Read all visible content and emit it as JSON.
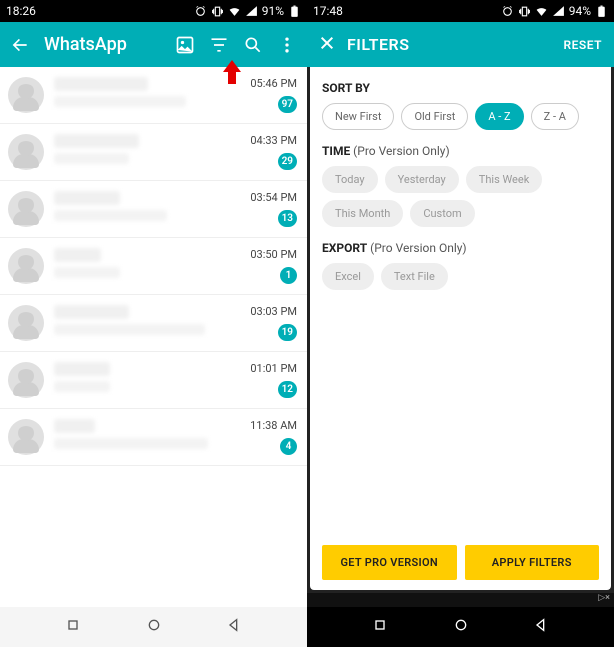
{
  "left": {
    "status": {
      "time": "18:26",
      "battery": "91%"
    },
    "appbar": {
      "title": "WhatsApp"
    },
    "chats": [
      {
        "time": "05:46 PM",
        "badge": "97",
        "nw": "50%",
        "mw": "70%"
      },
      {
        "time": "04:33 PM",
        "badge": "29",
        "nw": "45%",
        "mw": "40%"
      },
      {
        "time": "03:54 PM",
        "badge": "13",
        "nw": "35%",
        "mw": "60%"
      },
      {
        "time": "03:50 PM",
        "badge": "1",
        "nw": "25%",
        "mw": "35%"
      },
      {
        "time": "03:03 PM",
        "badge": "19",
        "nw": "40%",
        "mw": "80%"
      },
      {
        "time": "01:01 PM",
        "badge": "12",
        "nw": "30%",
        "mw": "30%"
      },
      {
        "time": "11:38 AM",
        "badge": "4",
        "nw": "22%",
        "mw": "82%"
      }
    ]
  },
  "right": {
    "status": {
      "time": "17:48",
      "battery": "94%"
    },
    "header": {
      "title": "FILTERS",
      "reset": "RESET"
    },
    "sections": {
      "sort": {
        "label": "SORT BY",
        "hint": "",
        "chips": [
          {
            "text": "New First",
            "state": "normal"
          },
          {
            "text": "Old First",
            "state": "normal"
          },
          {
            "text": "A - Z",
            "state": "active"
          },
          {
            "text": "Z - A",
            "state": "normal"
          }
        ]
      },
      "time": {
        "label": "TIME",
        "hint": " (Pro Version Only)",
        "chips": [
          {
            "text": "Today",
            "state": "disabled"
          },
          {
            "text": "Yesterday",
            "state": "disabled"
          },
          {
            "text": "This Week",
            "state": "disabled"
          },
          {
            "text": "This Month",
            "state": "disabled"
          },
          {
            "text": "Custom",
            "state": "disabled"
          }
        ]
      },
      "export": {
        "label": "EXPORT",
        "hint": " (Pro Version Only)",
        "chips": [
          {
            "text": "Excel",
            "state": "disabled"
          },
          {
            "text": "Text File",
            "state": "disabled"
          }
        ]
      }
    },
    "actions": {
      "pro": "GET PRO VERSION",
      "apply": "APPLY FILTERS"
    }
  }
}
